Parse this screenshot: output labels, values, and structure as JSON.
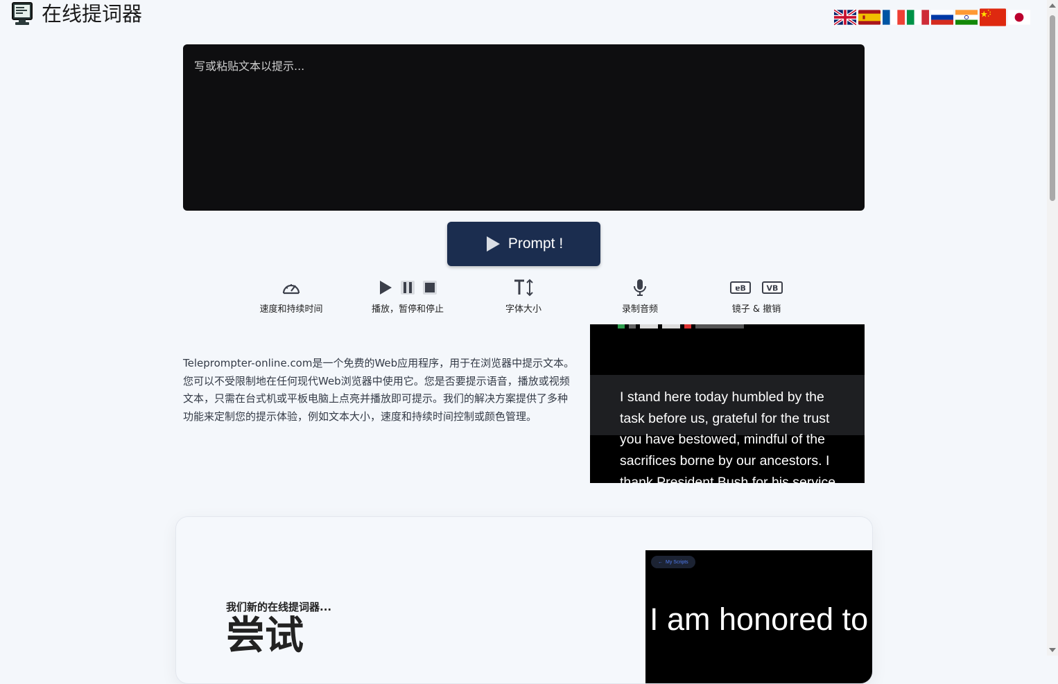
{
  "header": {
    "title": "在线提词器",
    "logo_icon": "monitor-icon",
    "languages": [
      {
        "code": "en",
        "icon": "uk-flag-icon"
      },
      {
        "code": "es",
        "icon": "spain-flag-icon"
      },
      {
        "code": "fr",
        "icon": "france-flag-icon"
      },
      {
        "code": "it",
        "icon": "italy-flag-icon"
      },
      {
        "code": "ru",
        "icon": "russia-flag-icon"
      },
      {
        "code": "hi",
        "icon": "india-flag-icon"
      },
      {
        "code": "zh",
        "icon": "china-flag-icon",
        "selected": true
      },
      {
        "code": "ja",
        "icon": "japan-flag-icon"
      }
    ]
  },
  "editor": {
    "placeholder": "写或粘贴文本以提示...",
    "value": ""
  },
  "prompt_button": {
    "label": "Prompt !",
    "icon": "play-icon"
  },
  "features": [
    {
      "label": "速度和持续时间",
      "icons": [
        "speedometer-icon"
      ]
    },
    {
      "label": "播放，暂停和停止",
      "icons": [
        "play-icon",
        "pause-icon",
        "stop-icon"
      ]
    },
    {
      "label": "字体大小",
      "icons": [
        "font-size-icon"
      ]
    },
    {
      "label": "录制音频",
      "icons": [
        "microphone-icon"
      ]
    },
    {
      "label": "镜子 & 撤销",
      "icons": [
        "mirror-icon",
        "flip-icon"
      ],
      "icon_text": [
        "ɐB",
        "VB"
      ]
    }
  ],
  "intro": {
    "text": "Teleprompter-online.com是一个免费的Web应用程序，用于在浏览器中提示文本。您可以不受限制地在任何现代Web浏览器中使用它。您是否要提示语音，播放或视频文本，只需在台式机或平板电脑上点亮并播放即可提示。我们的解决方案提供了多种功能来定制您的提示体验，例如文本大小，速度和持续时间控制或颜色管理。"
  },
  "demo_preview": {
    "text": "I stand here today humbled by the task before us, grateful for the trust you have bestowed, mindful of the sacrifices borne by our ancestors. I thank President Bush for his service"
  },
  "promo_card": {
    "subtitle": "我们新的在线提词器...",
    "title": "尝试",
    "preview_button": "My Scripts",
    "preview_text": "I am honored to b"
  },
  "colors": {
    "page_bg": "#f4f7fb",
    "editor_bg": "#0e0e10",
    "button_bg": "#1b2d4f",
    "text": "#333a46",
    "link": "#4f7cf2"
  }
}
